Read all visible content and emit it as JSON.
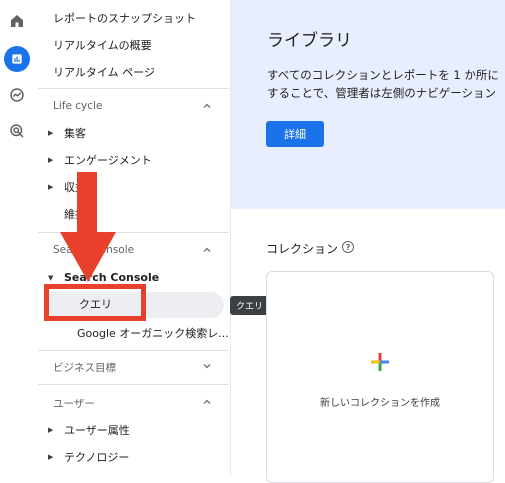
{
  "rail": {
    "icons": [
      "home-icon",
      "reports-icon",
      "explore-icon",
      "advertising-icon"
    ]
  },
  "sidebar": {
    "top_items": [
      "レポートのスナップショット",
      "リアルタイムの概要",
      "リアルタイム ページ"
    ],
    "lifecycle": {
      "header": "Life cycle",
      "items": [
        "集客",
        "エンゲージメント",
        "収益化",
        "維持率"
      ]
    },
    "search_console": {
      "header": "Search Console",
      "group_label": "Search Console",
      "items": [
        "クエリ",
        "Google オーガニック検索レ..."
      ]
    },
    "business_goals": {
      "header": "ビジネス目標"
    },
    "user": {
      "header": "ユーザー",
      "items": [
        "ユーザー属性",
        "テクノロジー"
      ]
    },
    "tooltip": "クエリ"
  },
  "library": {
    "title": "ライブラリ",
    "desc_line1": "すべてのコレクションとレポートを 1 か所に",
    "desc_line2": "することで、管理者は左側のナビゲーション",
    "button": "詳細"
  },
  "collections": {
    "title": "コレクション",
    "new_label": "新しいコレクションを作成"
  },
  "colors": {
    "accent": "#1a73e8",
    "annotation_red": "#e8412b",
    "hero_bg": "#e8eefd"
  }
}
